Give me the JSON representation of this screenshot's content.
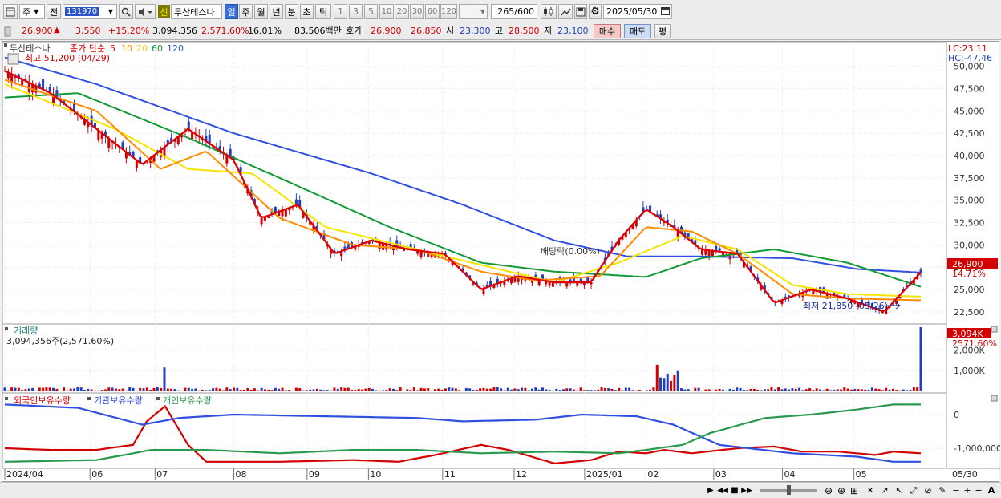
{
  "toolbar": {
    "period_mode": "주",
    "nav_label": "전",
    "stock_code": "131970",
    "new_badge": "신",
    "stock_name": "두산테스나",
    "periods": [
      "일",
      "주",
      "월",
      "년",
      "분",
      "초",
      "틱"
    ],
    "intervals": [
      "1",
      "3",
      "5",
      "10",
      "20",
      "30",
      "60",
      "120"
    ],
    "count": "265",
    "count_total": "/600",
    "date": "2025/05/30"
  },
  "quote": {
    "price": "26,900",
    "change": "3,550",
    "change_pct": "+15.20%",
    "volume": "3,094,356",
    "volume_ratio": "2,571.60%",
    "turnover": "16.01%",
    "amount": "83,506백만",
    "ask_label": "호가",
    "ask": "26,900",
    "bid": "26,850",
    "open_label": "시",
    "open": "23,300",
    "high_label": "고",
    "high": "28,500",
    "low_label": "저",
    "low": "23,100",
    "buy_label": "매수",
    "sell_label": "매도",
    "eval_label": "평"
  },
  "chart": {
    "legend_name": "두산테스나",
    "legend_price": "종가",
    "legend_type": "단순",
    "ma_periods": [
      "5",
      "10",
      "20",
      "60",
      "120"
    ],
    "ma_colors": [
      "#e00000",
      "#ff8c00",
      "#f5e400",
      "#119a36",
      "#2f50e0"
    ],
    "high_note": "최고 51,200 (04/29)",
    "low_note": "최저 21,850 (05/26)",
    "dividend_note": "배당락(0.00%)",
    "lc": "LC:23.11",
    "hc": "HC:-47.46",
    "current_price": "26,900",
    "current_pct": "14.71%",
    "volume_title": "거래량",
    "volume_summary": "3,094,356주(2,571.60%)",
    "volume_tag": "3,094K",
    "volume_pct": "2571.60%",
    "holders": [
      "외국인보유수량",
      "기관보유수량",
      "개인보유수량"
    ],
    "holder_colors": [
      "#d40000",
      "#2f50e0",
      "#2a9a50"
    ],
    "price_ticks": [
      "50,000",
      "47,500",
      "45,000",
      "42,500",
      "40,000",
      "37,500",
      "35,000",
      "32,500",
      "30,000",
      "27,500",
      "25,000",
      "22,500"
    ],
    "volume_ticks": [
      "2,000K",
      "1,000K"
    ],
    "holder_ticks": [
      "0",
      "-1,000,000"
    ],
    "x_labels": [
      "2024/04",
      "06",
      "07",
      "08",
      "09",
      "10",
      "11",
      "12",
      "2025/01",
      "02",
      "03",
      "04",
      "05"
    ],
    "x_end_label": "05/30"
  },
  "chart_data": {
    "type": "line",
    "title": "",
    "x_axis": [
      "2024/04",
      "06",
      "07",
      "08",
      "09",
      "10",
      "11",
      "12",
      "2025/01",
      "02",
      "03",
      "04",
      "05",
      "05/30"
    ],
    "series": [
      {
        "name": "5",
        "color": "#e00000",
        "points": [
          [
            0,
            49500
          ],
          [
            0.05,
            47000
          ],
          [
            0.1,
            43000
          ],
          [
            0.15,
            39000
          ],
          [
            0.2,
            43000
          ],
          [
            0.25,
            39500
          ],
          [
            0.28,
            33000
          ],
          [
            0.32,
            34500
          ],
          [
            0.36,
            29000
          ],
          [
            0.4,
            30500
          ],
          [
            0.44,
            29500
          ],
          [
            0.48,
            29000
          ],
          [
            0.52,
            25000
          ],
          [
            0.56,
            26500
          ],
          [
            0.6,
            25800
          ],
          [
            0.64,
            25800
          ],
          [
            0.67,
            30500
          ],
          [
            0.7,
            34000
          ],
          [
            0.73,
            32000
          ],
          [
            0.76,
            29500
          ],
          [
            0.8,
            29000
          ],
          [
            0.84,
            23500
          ],
          [
            0.88,
            25000
          ],
          [
            0.92,
            24000
          ],
          [
            0.96,
            22500
          ],
          [
            1.0,
            26900
          ]
        ]
      },
      {
        "name": "10",
        "color": "#ff8c00",
        "points": [
          [
            0,
            48500
          ],
          [
            0.1,
            45000
          ],
          [
            0.17,
            38500
          ],
          [
            0.22,
            40500
          ],
          [
            0.3,
            33000
          ],
          [
            0.38,
            30000
          ],
          [
            0.45,
            29500
          ],
          [
            0.52,
            27000
          ],
          [
            0.58,
            26000
          ],
          [
            0.65,
            26500
          ],
          [
            0.7,
            32000
          ],
          [
            0.75,
            31500
          ],
          [
            0.8,
            29000
          ],
          [
            0.86,
            24500
          ],
          [
            0.92,
            24000
          ],
          [
            1.0,
            23800
          ]
        ]
      },
      {
        "name": "20",
        "color": "#f5e400",
        "points": [
          [
            0,
            48000
          ],
          [
            0.12,
            43000
          ],
          [
            0.2,
            38500
          ],
          [
            0.27,
            38000
          ],
          [
            0.35,
            32000
          ],
          [
            0.45,
            29500
          ],
          [
            0.53,
            27500
          ],
          [
            0.6,
            25800
          ],
          [
            0.67,
            28000
          ],
          [
            0.74,
            31000
          ],
          [
            0.8,
            29500
          ],
          [
            0.86,
            25500
          ],
          [
            0.92,
            24500
          ],
          [
            1.0,
            24200
          ]
        ]
      },
      {
        "name": "60",
        "color": "#119a36",
        "points": [
          [
            0,
            46500
          ],
          [
            0.08,
            47000
          ],
          [
            0.2,
            42000
          ],
          [
            0.3,
            37500
          ],
          [
            0.42,
            32000
          ],
          [
            0.52,
            28000
          ],
          [
            0.6,
            27000
          ],
          [
            0.7,
            26400
          ],
          [
            0.76,
            28500
          ],
          [
            0.84,
            29500
          ],
          [
            0.92,
            28000
          ],
          [
            1.0,
            25300
          ]
        ]
      },
      {
        "name": "120",
        "color": "#2f50e0",
        "points": [
          [
            0,
            51000
          ],
          [
            0.1,
            48000
          ],
          [
            0.25,
            42500
          ],
          [
            0.4,
            38000
          ],
          [
            0.5,
            34500
          ],
          [
            0.6,
            30500
          ],
          [
            0.68,
            28700
          ],
          [
            0.76,
            28700
          ],
          [
            0.86,
            28500
          ],
          [
            0.93,
            27300
          ],
          [
            1.0,
            26900
          ]
        ]
      }
    ],
    "price_ylim": [
      21500,
      51500
    ],
    "volume_max": 3094356,
    "volume_unit": "주",
    "holder_ylim": [
      -1500000,
      500000
    ]
  }
}
